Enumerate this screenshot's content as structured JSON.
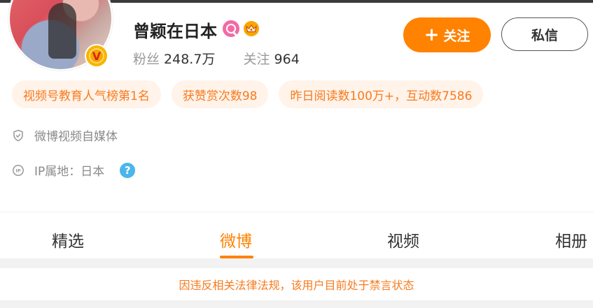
{
  "profile": {
    "name": "曾颖在日本",
    "followers_label": "粉丝",
    "followers_value": "248.7万",
    "following_label": "关注",
    "following_value": "964",
    "verified_badge": "V"
  },
  "actions": {
    "follow_plus": "+",
    "follow_label": "关注",
    "message_label": "私信"
  },
  "tags": [
    "视频号教育人气榜第1名",
    "获赞赏次数98",
    "昨日阅读数100万+，互动数7586"
  ],
  "info": {
    "verification": "微博视频自媒体",
    "ip_location": "IP属地：日本",
    "help_icon_glyph": "?"
  },
  "tabs": [
    {
      "label": "精选"
    },
    {
      "label": "微博"
    },
    {
      "label": "视频"
    },
    {
      "label": "相册"
    }
  ],
  "active_tab": "微博",
  "notice": "因违反相关法律法规，该用户目前处于禁言状态",
  "icons": [
    "search-badge-icon",
    "crown-icon",
    "verified-v-icon",
    "shield-check-icon",
    "ip-icon",
    "help-icon"
  ],
  "colors": {
    "accent": "#ff8200",
    "tag_text": "#f77b1e",
    "tag_bg": "#fff3ea",
    "help_blue": "#4ab6ec"
  }
}
